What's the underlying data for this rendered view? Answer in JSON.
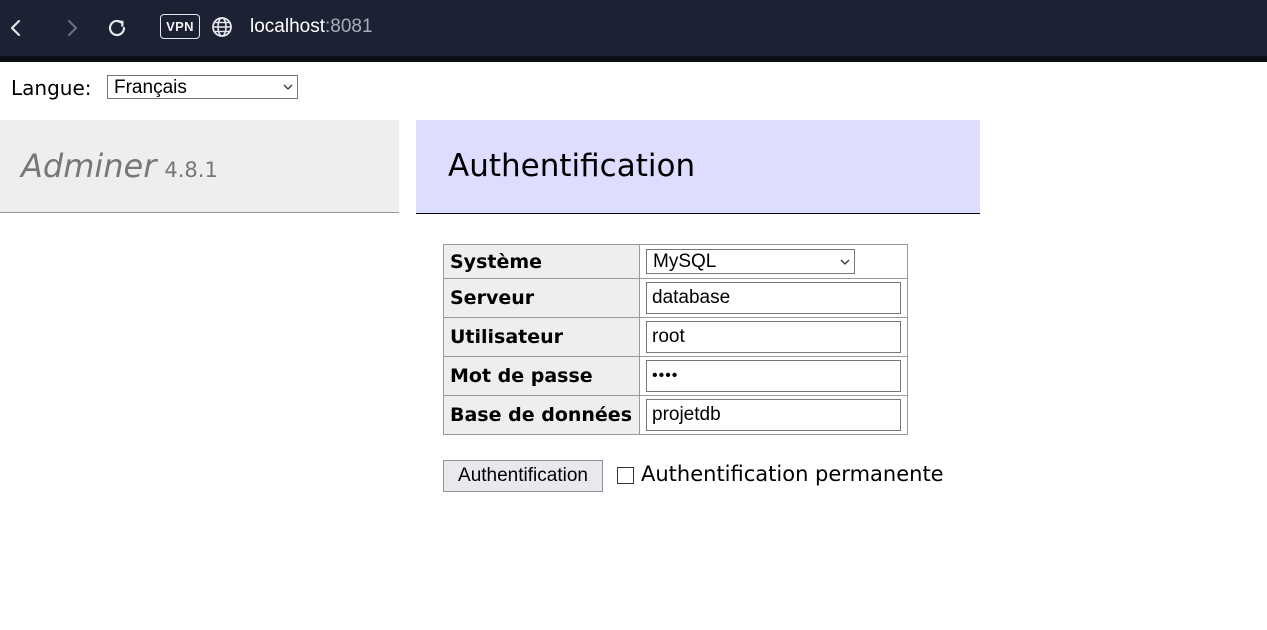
{
  "browser": {
    "vpn_label": "VPN",
    "url_host": "localhost",
    "url_port": ":8081"
  },
  "language": {
    "label": "Langue:",
    "selected": "Français"
  },
  "menu": {
    "brand_name": "Adminer",
    "version": "4.8.1"
  },
  "content": {
    "title": "Authentification"
  },
  "form": {
    "rows": [
      {
        "label": "Système",
        "value": "MySQL"
      },
      {
        "label": "Serveur",
        "value": "database"
      },
      {
        "label": "Utilisateur",
        "value": "root"
      },
      {
        "label": "Mot de passe",
        "value": "••••"
      },
      {
        "label": "Base de données",
        "value": "projetdb"
      }
    ],
    "submit_label": "Authentification",
    "permanent_label": "Authentification permanente"
  }
}
